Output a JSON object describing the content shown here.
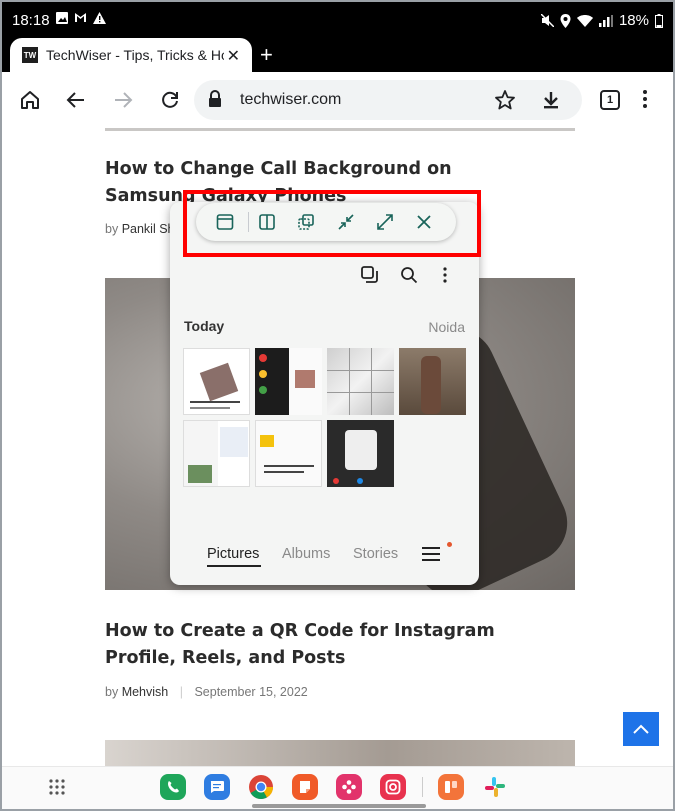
{
  "status_bar": {
    "time": "18:18",
    "battery": "18%"
  },
  "tab": {
    "title": "TechWiser - Tips, Tricks & Ho",
    "favicon_text": "TW",
    "close_symbol": "✕",
    "new_tab_symbol": "+"
  },
  "toolbar": {
    "url": "techwiser.com",
    "tab_count": "1"
  },
  "articles": [
    {
      "title": "How to Change Call Background on Samsung Galaxy Phones",
      "by": "by",
      "author": "Pankil Sh"
    },
    {
      "title": "How to Create a QR Code for Instagram Profile, Reels, and Posts",
      "by": "by",
      "author": "Mehvish",
      "date": "September 15, 2022"
    }
  ],
  "popup_window": {
    "app": "Gallery",
    "section_title": "Today",
    "location": "Noida",
    "nav_tabs": [
      "Pictures",
      "Albums",
      "Stories"
    ],
    "active_tab": "Pictures"
  },
  "popup_controls": {
    "buttons": [
      "window-icon",
      "split-screen-icon",
      "pop-up-view-icon",
      "minimize-icon",
      "maximize-icon",
      "close-icon"
    ]
  },
  "highlight_color": "#ff0000",
  "accent_color": "#1e73e8",
  "dock_apps": [
    "phone-icon",
    "messages-icon",
    "chrome-icon",
    "notes-icon",
    "flower-app-icon",
    "camera-app-icon",
    "photo-editor-icon",
    "slack-icon"
  ]
}
